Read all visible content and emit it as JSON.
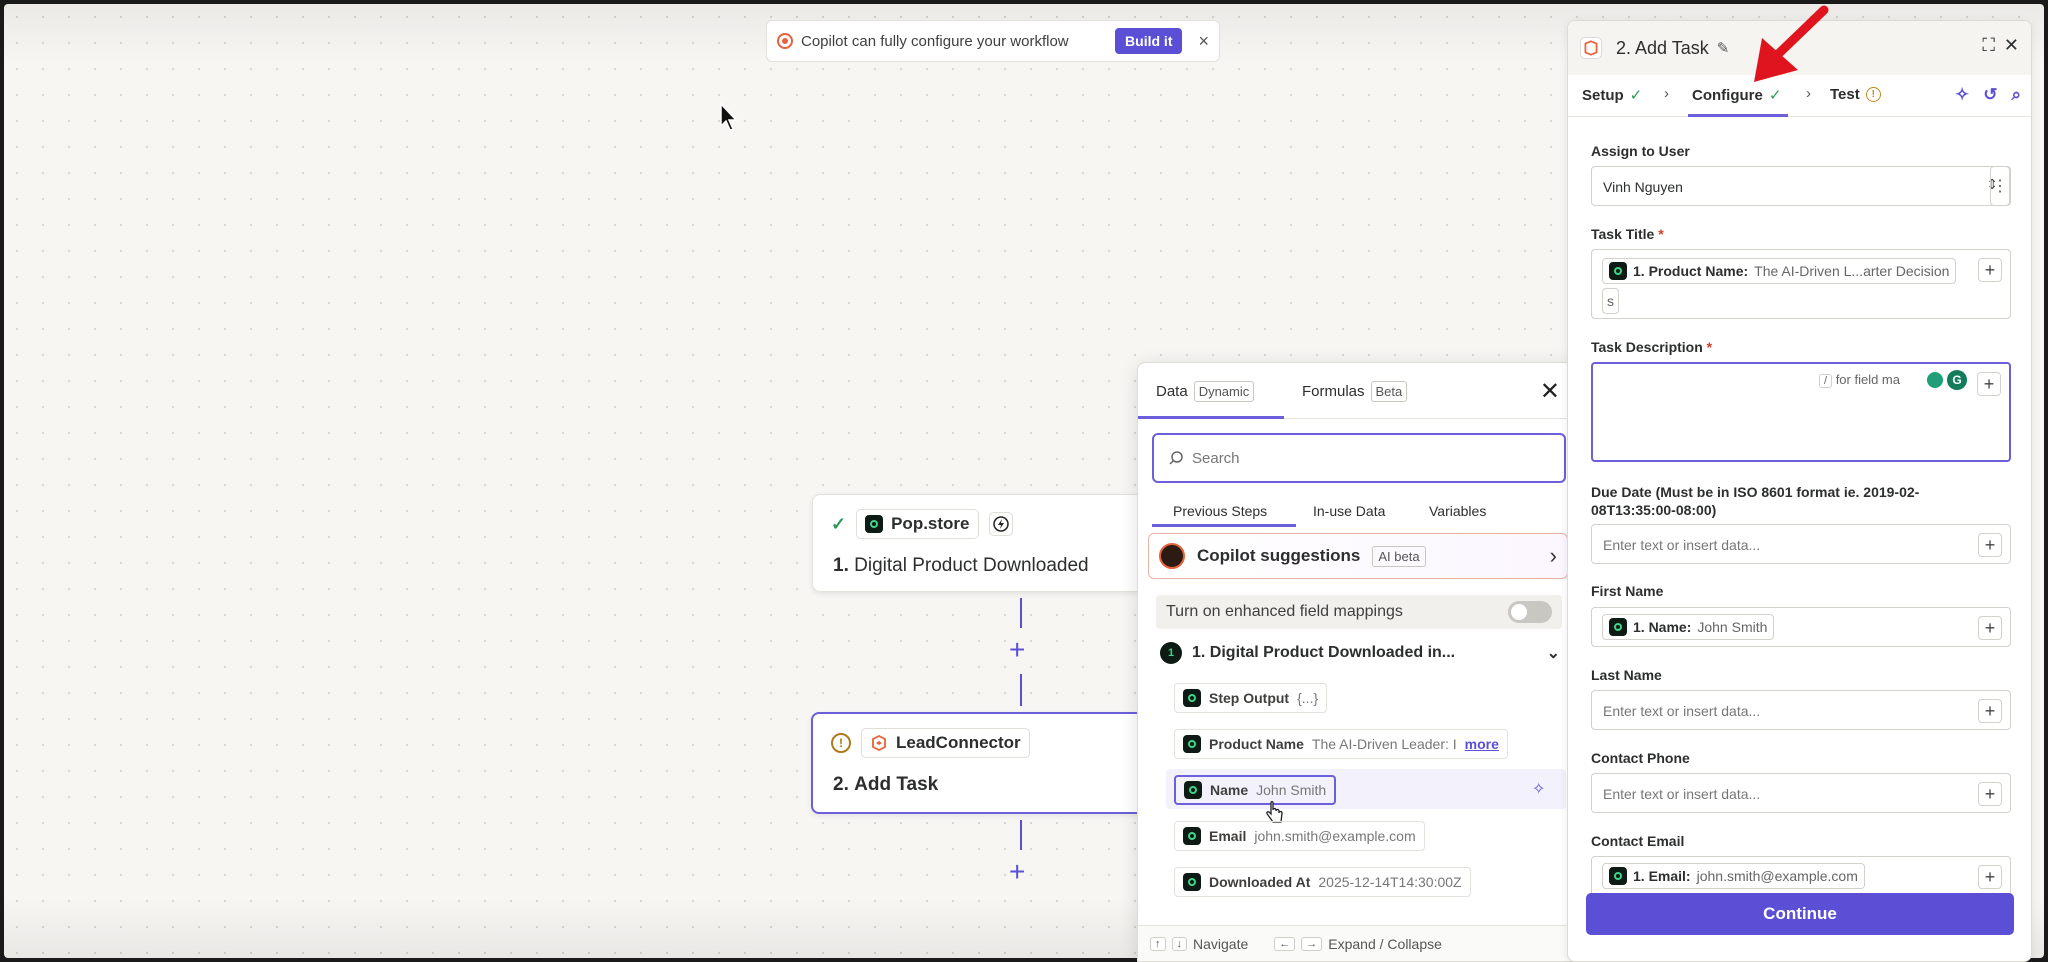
{
  "banner": {
    "text": "Copilot can fully configure your workflow",
    "button": "Build it",
    "close": "×"
  },
  "nodes": [
    {
      "app": "Pop.store",
      "title_num": "1.",
      "title": "Digital Product Downloaded"
    },
    {
      "app": "LeadConnector",
      "title_num": "2.",
      "title": "Add Task"
    }
  ],
  "picker": {
    "tab_data": "Data",
    "tab_data_tag": "Dynamic",
    "tab_formulas": "Formulas",
    "tab_formulas_tag": "Beta",
    "close": "✕",
    "search_placeholder": "Search",
    "subtabs": [
      "Previous Steps",
      "In-use Data",
      "Variables"
    ],
    "copilot": {
      "title": "Copilot suggestions",
      "tag": "AI beta"
    },
    "enhanced": "Turn on enhanced field mappings",
    "group": {
      "num": "1",
      "title": "1.  Digital Product Downloaded in..."
    },
    "items": [
      {
        "label": "Step Output",
        "value": "{...}"
      },
      {
        "label": "Product Name",
        "value": "The AI-Driven Leader: I",
        "more": "more"
      },
      {
        "label": "Name",
        "value": "John Smith"
      },
      {
        "label": "Email",
        "value": "john.smith@example.com"
      },
      {
        "label": "Downloaded At",
        "value": "2025-12-14T14:30:00Z"
      }
    ],
    "footer": {
      "navigate": "Navigate",
      "expand": "Expand / Collapse"
    }
  },
  "panel": {
    "title": "2. Add Task",
    "steps": [
      {
        "label": "Setup"
      },
      {
        "label": "Configure"
      },
      {
        "label": "Test"
      }
    ],
    "fields": {
      "assign_label": "Assign to User",
      "assign_value": "Vinh Nguyen",
      "task_title_label": "Task Title",
      "task_title_token_label": "1. Product Name:",
      "task_title_token_value": "The AI-Driven L...arter Decision",
      "task_title_tail": "s",
      "task_desc_label": "Task Description",
      "task_desc_hint": "for field ma",
      "due_label": "Due Date (Must be in ISO 8601 format ie. 2019-02-08T13:35:00-08:00)",
      "placeholder": "Enter text or insert data...",
      "first_name_label": "First Name",
      "first_name_token_label": "1. Name:",
      "first_name_token_value": "John Smith",
      "last_name_label": "Last Name",
      "contact_phone_label": "Contact Phone",
      "contact_email_label": "Contact Email",
      "contact_email_token_label": "1. Email:",
      "contact_email_token_value": "john.smith@example.com"
    },
    "continue": "Continue"
  },
  "colors": {
    "accent": "#5b4fd6",
    "success": "#2e9a5a",
    "warning": "#c48a1d",
    "arrow": "#e0141e"
  }
}
